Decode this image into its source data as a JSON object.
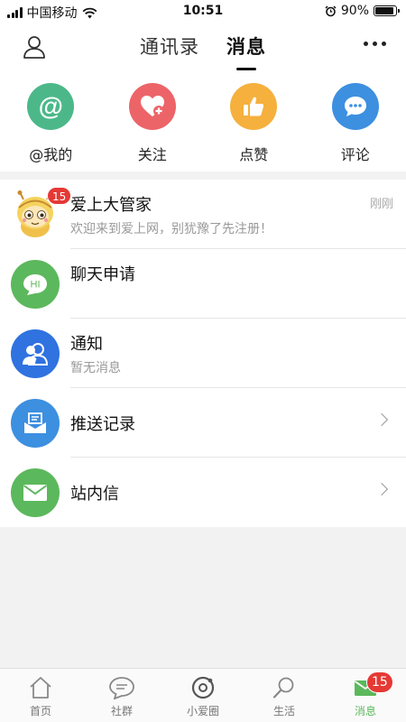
{
  "status_bar": {
    "carrier": "中国移动",
    "time": "10:51",
    "battery": "90%",
    "battery_fraction": 0.9
  },
  "header": {
    "tabs": [
      "通讯录",
      "消息"
    ],
    "active_tab": 1
  },
  "quick_actions": [
    {
      "label": "@我的",
      "icon": "at-icon",
      "color": "#4cb88a"
    },
    {
      "label": "关注",
      "icon": "heart-plus-icon",
      "color": "#ec6468"
    },
    {
      "label": "点赞",
      "icon": "thumbs-up-icon",
      "color": "#f5b03d"
    },
    {
      "label": "评论",
      "icon": "chat-bubble-icon",
      "color": "#3d8fe0"
    }
  ],
  "messages": [
    {
      "title": "爱上大管家",
      "subtitle": "欢迎来到爱上网，别犹豫了先注册！",
      "time": "刚刚",
      "badge": "15",
      "icon": "mascot-avatar"
    },
    {
      "title": "聊天申请",
      "subtitle": "",
      "icon": "hi-chat-icon",
      "color": "#5cb85c"
    },
    {
      "title": "通知",
      "subtitle": "暂无消息",
      "icon": "people-icon",
      "color": "#2f72e0"
    },
    {
      "title": "推送记录",
      "icon": "inbox-icon",
      "color": "#3d8fe0"
    },
    {
      "title": "站内信",
      "icon": "envelope-icon",
      "color": "#5cb85c"
    }
  ],
  "bottom_nav": {
    "items": [
      "首页",
      "社群",
      "小爱圈",
      "生活",
      "消息"
    ],
    "active": 4,
    "badge": "15"
  }
}
